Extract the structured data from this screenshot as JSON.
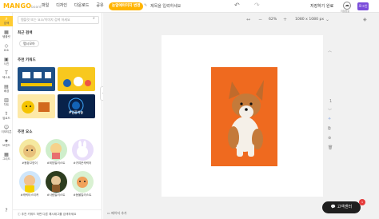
{
  "header": {
    "logo": "MANGO",
    "logo_sub": "board",
    "menu": [
      "파일",
      "디자인",
      "다운로드",
      "공유",
      "인쇄"
    ],
    "template_button": "눈앞에이미지 변경",
    "doc_title": "제목을 입력하세요",
    "save_label": "저장하기 완료",
    "badge_label": "저장완료",
    "login_label": "로그인"
  },
  "nav": {
    "items": [
      {
        "label": "검색"
      },
      {
        "label": "템플릿"
      },
      {
        "label": "요소"
      },
      {
        "label": "사진"
      },
      {
        "label": "텍스트"
      },
      {
        "label": "배경"
      },
      {
        "label": "차트"
      },
      {
        "label": "업로드"
      },
      {
        "label": "이모티콘"
      },
      {
        "label": "브랜드"
      },
      {
        "label": "그리드"
      }
    ]
  },
  "panel": {
    "search_placeholder": "템플릿 또는 요소/이미지 검색 하세요",
    "recent_title": "최근 검색",
    "recent_chip": "펩시모아",
    "recommend_title": "추천 키워드",
    "thumb_labels": [
      "",
      "",
      "",
      "#인공지능"
    ],
    "element_title": "추천 요소",
    "circles": [
      {
        "label": "#봉황고양이"
      },
      {
        "label": "#희망일러스트"
      },
      {
        "label": "#귀여운캐릭터"
      },
      {
        "label": "#캐릭터스티커"
      },
      {
        "label": "#사람일러스트"
      },
      {
        "label": "#동물일러스트"
      }
    ],
    "notice": "추천 키워드 하면 다른 해시태그를 검색하세요"
  },
  "workarea": {
    "zoom": "62%",
    "dims": "1080 x 1080 px",
    "page_button": "페이지 추가"
  },
  "right_tools": {
    "page_no": "1"
  },
  "help": {
    "label": "고객센터",
    "badge": "1"
  },
  "colors": {
    "accent": "#ffb400",
    "login": "#7a4ddb",
    "photo_bg": "#ef6a1f"
  }
}
